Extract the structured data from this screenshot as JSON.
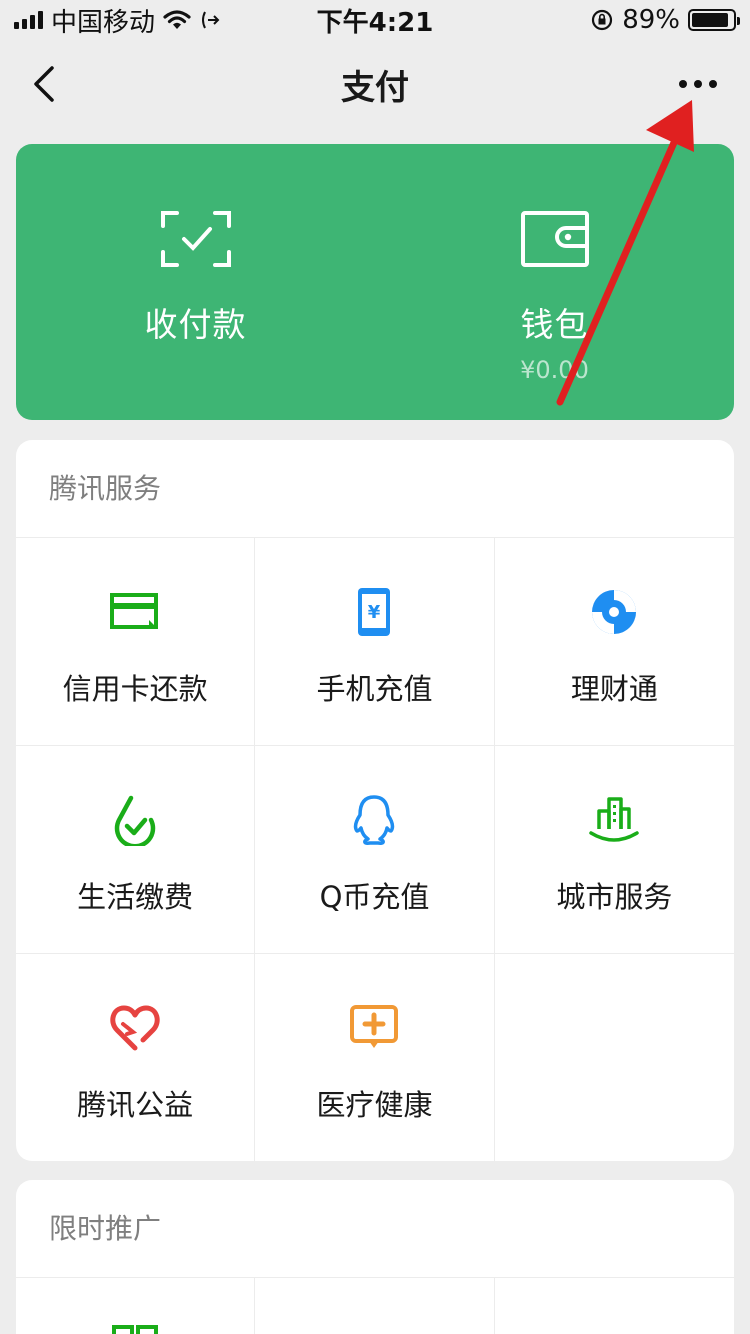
{
  "status_bar": {
    "carrier": "中国移动",
    "time": "下午4:21",
    "battery_text": "89%",
    "battery_level": 0.89
  },
  "nav": {
    "title": "支付",
    "back_icon": "chevron-left-icon",
    "more_icon": "more-dots-icon"
  },
  "pay_card": {
    "color": "#3eb574",
    "items": [
      {
        "label": "收付款",
        "icon": "scan-check-icon"
      },
      {
        "label": "钱包",
        "sub": "¥0.00",
        "icon": "wallet-icon"
      }
    ]
  },
  "tencent_services": {
    "title": "腾讯服务",
    "items": [
      {
        "label": "信用卡还款",
        "icon": "credit-card-icon"
      },
      {
        "label": "手机充值",
        "icon": "phone-topup-icon"
      },
      {
        "label": "理财通",
        "icon": "wealth-icon"
      },
      {
        "label": "生活缴费",
        "icon": "utility-bill-icon"
      },
      {
        "label": "Q币充值",
        "icon": "qq-coin-icon"
      },
      {
        "label": "城市服务",
        "icon": "city-service-icon"
      },
      {
        "label": "腾讯公益",
        "icon": "charity-icon"
      },
      {
        "label": "医疗健康",
        "icon": "medical-icon"
      }
    ]
  },
  "promotions": {
    "title": "限时推广"
  },
  "colors": {
    "green": "#1aad19",
    "blue": "#1f8ef1",
    "red": "#e64340",
    "orange": "#f19935",
    "annotation_arrow": "#e02020"
  }
}
